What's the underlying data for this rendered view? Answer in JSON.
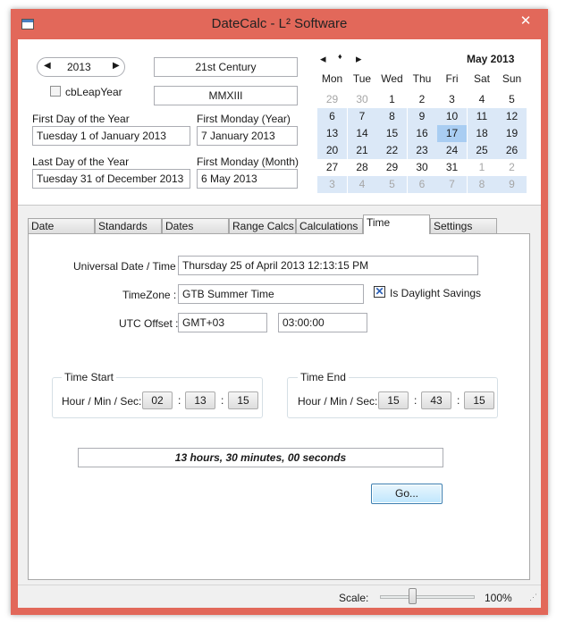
{
  "window": {
    "title": "DateCalc - L² Software"
  },
  "top": {
    "year_value": "2013",
    "leap_checkbox_label": "cbLeapYear",
    "century": "21st Century",
    "roman": "MMXIII",
    "first_day_label": "First Day of the Year",
    "first_day_value": "Tuesday 1 of January 2013",
    "first_monday_year_label": "First Monday (Year)",
    "first_monday_year_value": "7 January 2013",
    "last_day_label": "Last Day of the Year",
    "last_day_value": "Tuesday 31 of December 2013",
    "first_monday_month_label": "First Monday (Month)",
    "first_monday_month_value": "6 May 2013"
  },
  "calendar": {
    "month_label": "May 2013",
    "days": [
      "Mon",
      "Tue",
      "Wed",
      "Thu",
      "Fri",
      "Sat",
      "Sun"
    ],
    "weeks": [
      [
        "29",
        "30",
        "1",
        "2",
        "3",
        "4",
        "5"
      ],
      [
        "6",
        "7",
        "8",
        "9",
        "10",
        "11",
        "12"
      ],
      [
        "13",
        "14",
        "15",
        "16",
        "17",
        "18",
        "19"
      ],
      [
        "20",
        "21",
        "22",
        "23",
        "24",
        "25",
        "26"
      ],
      [
        "27",
        "28",
        "29",
        "30",
        "31",
        "1",
        "2"
      ],
      [
        "3",
        "4",
        "5",
        "6",
        "7",
        "8",
        "9"
      ]
    ],
    "selected_day": "17",
    "prev_icon": "◂",
    "dot_icon": "♦",
    "next_icon": "▸"
  },
  "tabs": [
    "Date",
    "Standards",
    "Dates",
    "Range Calcs",
    "Calculations",
    "Time",
    "Settings"
  ],
  "time_tab": {
    "universal_label": "Universal Date / Time :",
    "universal_value": "Thursday 25 of April 2013   12:13:15  PM",
    "timezone_label": "TimeZone :",
    "timezone_value": "GTB Summer Time",
    "daylight_label": "Is Daylight Savings",
    "utc_label": "UTC Offset :",
    "utc_value1": "GMT+03",
    "utc_value2": "03:00:00",
    "start_group": "Time Start",
    "start_hms_label": "Hour / Min / Sec:",
    "start_h": "02",
    "start_m": "13",
    "start_s": "15",
    "end_group": "Time End",
    "end_hms_label": "Hour / Min / Sec:",
    "end_h": "15",
    "end_m": "43",
    "end_s": "15",
    "colon": ":",
    "result": "13 hours, 30 minutes, 00 seconds",
    "go_button": "Go..."
  },
  "status": {
    "scale_label": "Scale:",
    "scale_value": "100%",
    "scale_level": 0.35
  },
  "colors": {
    "frame": "#e2685a",
    "calendar_highlight": "#dbe8f7",
    "selected": "#a9cdf2"
  }
}
